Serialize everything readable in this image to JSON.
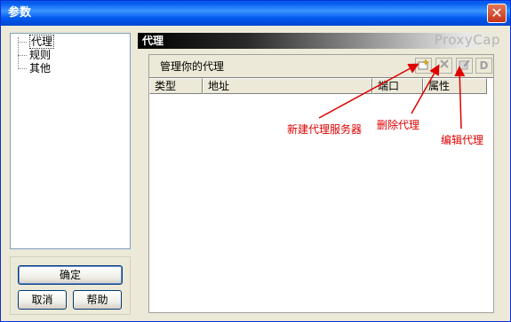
{
  "window": {
    "title": "参数",
    "close_glyph": "✕"
  },
  "sidebar": {
    "items": [
      {
        "label": "代理",
        "selected": true
      },
      {
        "label": "规则",
        "selected": false
      },
      {
        "label": "其他",
        "selected": false
      }
    ]
  },
  "buttons": {
    "ok": "确定",
    "cancel": "取消",
    "help": "帮助"
  },
  "header": {
    "title": "代理",
    "brand": "ProxyCap"
  },
  "panel": {
    "caption": "管理你的代理",
    "toolbar": {
      "new_icon": "new-proxy-icon",
      "delete_icon": "delete-proxy-icon",
      "edit_icon": "edit-proxy-icon",
      "d_label": "D"
    },
    "columns": [
      "类型",
      "地址",
      "端口",
      "属性"
    ],
    "rows": []
  },
  "annotations": {
    "new_server": "新建代理服务器",
    "delete_proxy": "删除代理",
    "edit_proxy": "编辑代理",
    "color": "#E00000"
  }
}
